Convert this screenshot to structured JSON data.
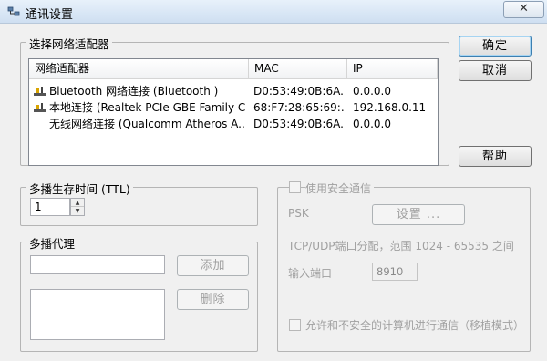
{
  "window": {
    "title": "通讯设置",
    "close_glyph": "✕"
  },
  "adapter_group": {
    "legend": "选择网络适配器",
    "columns": [
      "网络适配器",
      "MAC",
      "IP"
    ],
    "rows": [
      {
        "name": "Bluetooth 网络连接 (Bluetooth )",
        "mac": "D0:53:49:0B:6A...",
        "ip": "0.0.0.0",
        "icon": "network-connected-icon"
      },
      {
        "name": "本地连接 (Realtek PCIe GBE Family C...",
        "mac": "68:F7:28:65:69:...",
        "ip": "192.168.0.11",
        "icon": "network-connected-icon"
      },
      {
        "name": "无线网络连接 (Qualcomm Atheros A...",
        "mac": "D0:53:49:0B:6A...",
        "ip": "0.0.0.0",
        "icon": ""
      }
    ]
  },
  "buttons": {
    "ok": "确定",
    "cancel": "取消",
    "help": "帮助"
  },
  "ttl_group": {
    "legend": "多播生存时间 (TTL)",
    "value": "1"
  },
  "proxy_group": {
    "legend": "多播代理",
    "add_label": "添加",
    "delete_label": "删除"
  },
  "secure_group": {
    "checkbox_label": "使用安全通信",
    "psk_label": "PSK",
    "settings_label": "设置 ...",
    "port_range_text": "TCP/UDP端口分配，范围 1024 - 65535 之间",
    "input_port_label": "输入端口",
    "input_port_value": "8910",
    "allow_insecure_label": "允许和不安全的计算机进行通信（移植模式）"
  }
}
